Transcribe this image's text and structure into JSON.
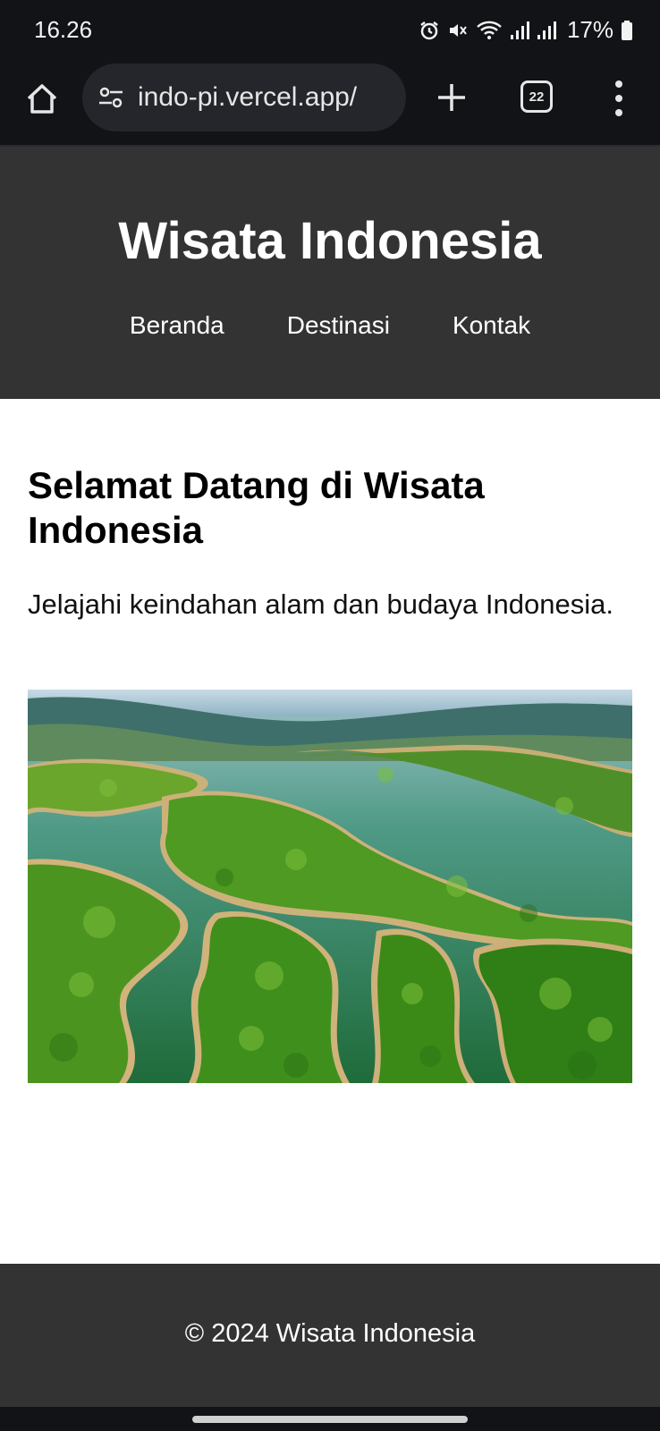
{
  "status_bar": {
    "time": "16.26",
    "battery": "17%",
    "icons": [
      "alarm-icon",
      "mute-icon",
      "wifi-icon",
      "signal-icon",
      "signal-icon",
      "battery-icon"
    ]
  },
  "browser": {
    "url": "indo-pi.vercel.app/",
    "tab_count": "22",
    "icons": [
      "home-icon",
      "site-settings-icon",
      "new-tab-icon",
      "tabs-icon",
      "more-icon"
    ]
  },
  "site": {
    "title": "Wisata Indonesia",
    "nav": [
      "Beranda",
      "Destinasi",
      "Kontak"
    ]
  },
  "main": {
    "heading": "Selamat Datang di Wisata Indonesia",
    "intro": "Jelajahi keindahan alam dan budaya Indonesia."
  },
  "footer": {
    "text": "© 2024 Wisata Indonesia"
  },
  "colors": {
    "system_bar": "#111316",
    "header_footer": "#333333",
    "water": "#2f7a4a",
    "forest": "#4a9a24"
  }
}
